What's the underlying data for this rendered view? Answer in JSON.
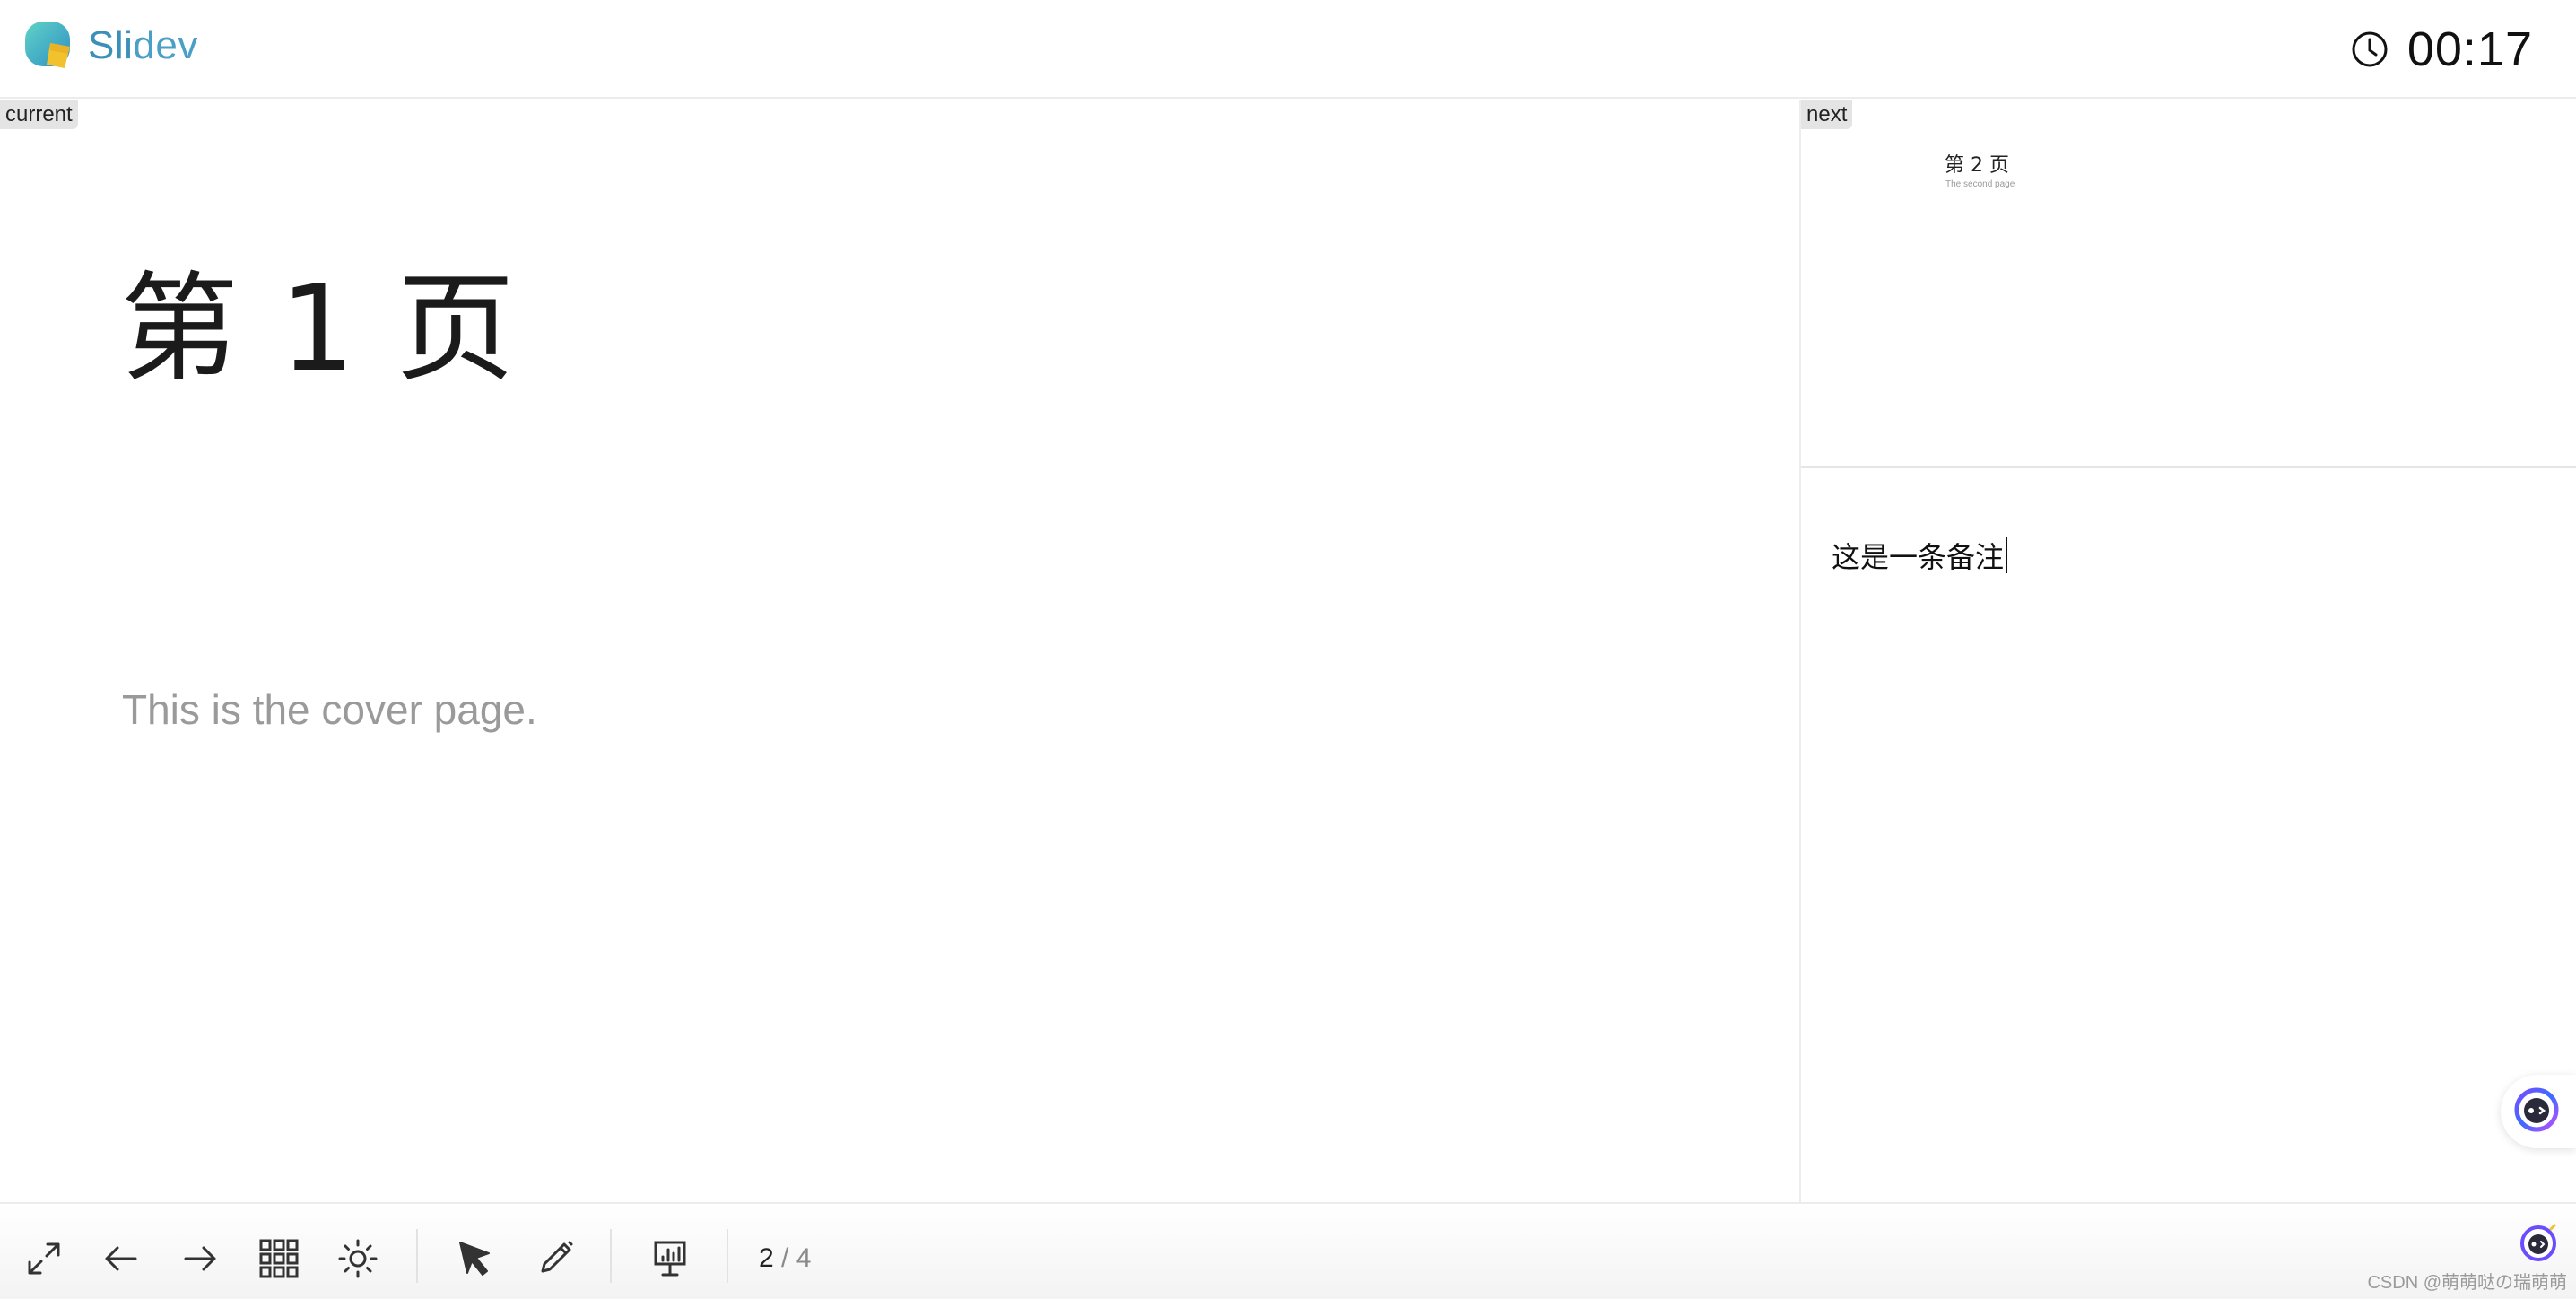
{
  "header": {
    "logo_text_a": "Sli",
    "logo_text_b": "dev",
    "timer": "00:17"
  },
  "current": {
    "tag": "current",
    "title": "第 1 页",
    "subtitle": "This is the cover page."
  },
  "next": {
    "tag": "next",
    "title": "第 2 页",
    "subtitle": "The second page"
  },
  "notes": {
    "text": "这是一条备注"
  },
  "toolbar": {
    "icons": [
      "fullscreen-icon",
      "arrow-left-icon",
      "arrow-right-icon",
      "grid-icon",
      "sun-icon",
      "cursor-icon",
      "pen-icon",
      "presenter-icon"
    ],
    "page_current": "2",
    "page_sep": " / ",
    "page_total": "4"
  },
  "watermark": "CSDN @萌萌哒の瑞萌萌",
  "colors": {
    "brand": "#3b8fb8",
    "logo_teal": "#3fc3c0",
    "logo_yellow": "#f2c12e"
  }
}
